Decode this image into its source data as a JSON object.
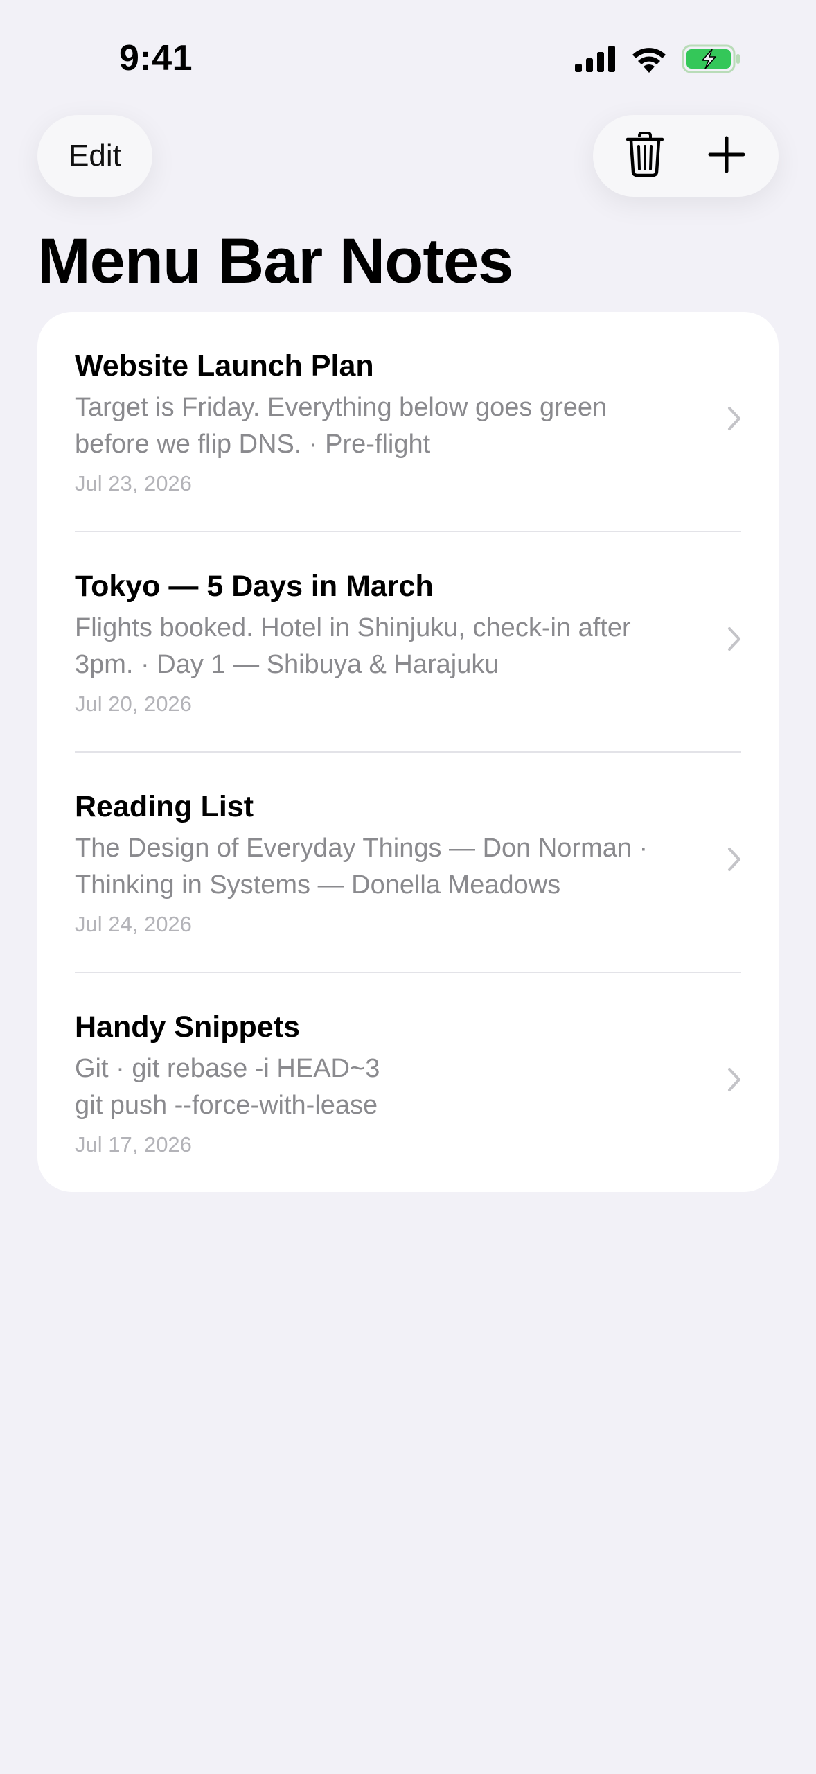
{
  "status_bar": {
    "time": "9:41"
  },
  "nav": {
    "edit_label": "Edit"
  },
  "page": {
    "title": "Menu Bar Notes"
  },
  "notes": [
    {
      "title": "Website Launch Plan",
      "preview_line1": "Target is Friday. Everything below goes green",
      "preview_line2": "before we flip DNS. · Pre-flight",
      "date": "Jul 23, 2026"
    },
    {
      "title": "Tokyo — 5 Days in March",
      "preview_line1": "Flights booked. Hotel in Shinjuku, check-in after",
      "preview_line2": "3pm. · Day 1 — Shibuya & Harajuku",
      "date": "Jul 20, 2026"
    },
    {
      "title": "Reading List",
      "preview_line1": "The Design of Everyday Things — Don Norman ·",
      "preview_line2": "Thinking in Systems — Donella Meadows",
      "date": "Jul 24, 2026"
    },
    {
      "title": "Handy Snippets",
      "preview_line1": "Git · git rebase -i HEAD~3",
      "preview_line2": "git push --force-with-lease",
      "date": "Jul 17, 2026"
    }
  ],
  "icons": {
    "signal": "cellular-signal-icon",
    "wifi": "wifi-icon",
    "battery": "battery-charging-icon",
    "trash": "trash-icon",
    "plus": "plus-icon",
    "chevron": "chevron-right-icon"
  },
  "colors": {
    "background": "#f2f1f7",
    "card": "#ffffff",
    "secondary_text": "#8a8a8e",
    "tertiary_text": "#b3b3b8",
    "battery_green": "#34c759"
  }
}
